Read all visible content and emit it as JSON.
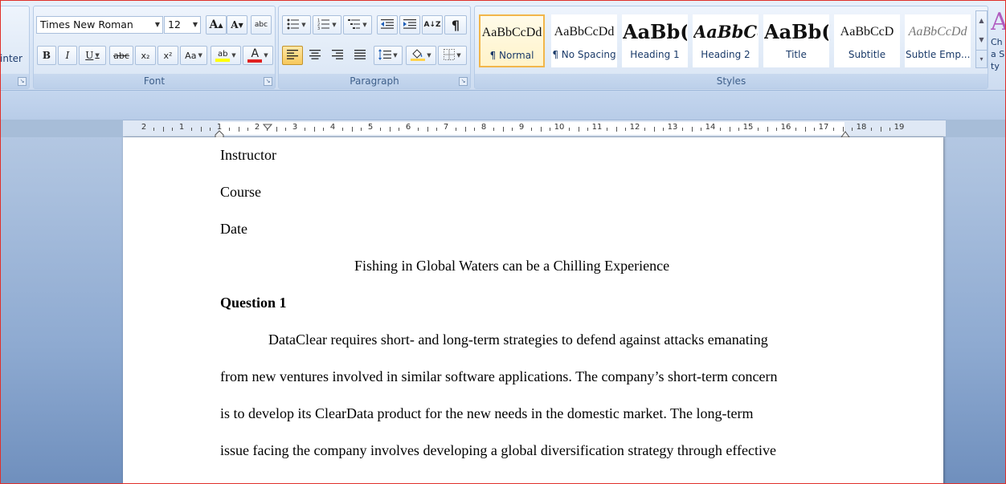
{
  "ribbon": {
    "clipboard": {
      "format_painter_partial": "inter"
    },
    "font": {
      "group_label": "Font",
      "font_name": "Times New Roman",
      "font_size": "12",
      "grow_label": "A",
      "shrink_label": "A",
      "clear_format_label": "abc",
      "bold_label": "B",
      "italic_label": "I",
      "underline_label": "U",
      "strike_label": "abc",
      "subscript_label": "x₂",
      "superscript_label": "x²",
      "change_case_label": "Aa",
      "highlight_label": "ab",
      "font_color_label": "A",
      "highlight_color": "#ffff00",
      "font_color": "#e02020"
    },
    "paragraph": {
      "group_label": "Paragraph",
      "sort_label": "A↓Z",
      "show_marks_label": "¶"
    },
    "styles": {
      "group_label": "Styles",
      "tiles": [
        {
          "sample": "AaBbCcDd",
          "name": "¶ Normal"
        },
        {
          "sample": "AaBbCcDd",
          "name": "¶ No Spacing"
        },
        {
          "sample": "AaBb(",
          "name": "Heading 1"
        },
        {
          "sample": "AaBbCc",
          "name": "Heading 2"
        },
        {
          "sample": "AaBb(",
          "name": "Title"
        },
        {
          "sample": "AaBbCcD",
          "name": "Subtitle"
        },
        {
          "sample": "AaBbCcDd",
          "name": "Subtle Emp..."
        }
      ],
      "change_styles_partial": "Cha Sty"
    }
  },
  "ruler": {
    "labels": [
      "2",
      "1",
      "1",
      "2",
      "3",
      "4",
      "5",
      "6",
      "7",
      "8",
      "9",
      "10",
      "11",
      "12",
      "13",
      "14",
      "15",
      "16",
      "17",
      "18",
      "19"
    ]
  },
  "document": {
    "lines": [
      "Instructor",
      "Course",
      "Date",
      "Fishing in Global Waters can be a Chilling Experience",
      "Question 1",
      "DataClear requires short- and long-term strategies to defend against attacks emanating",
      "from new ventures involved in similar software applications. The company’s short-term concern",
      "is to develop its ClearData product for the new needs in the domestic market. The long-term",
      "issue facing the company  involves developing a global diversification strategy through effective"
    ]
  }
}
